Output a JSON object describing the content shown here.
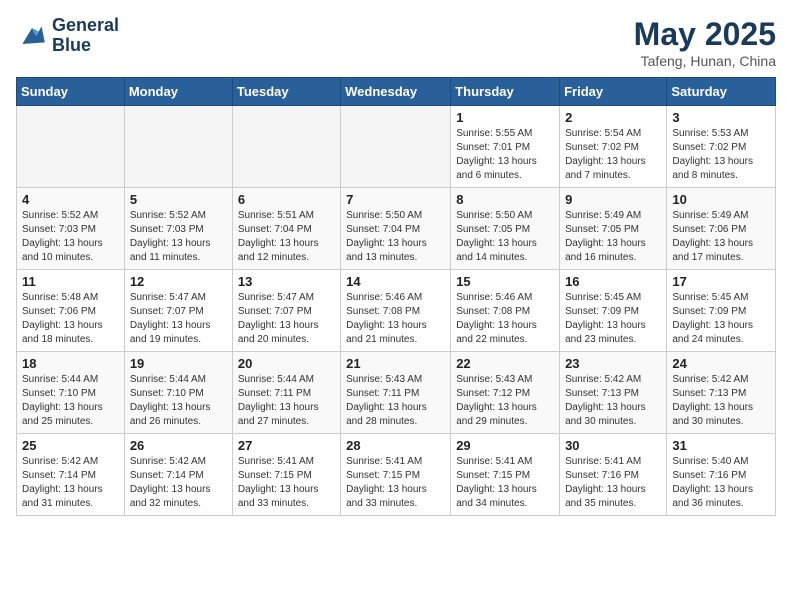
{
  "header": {
    "logo_line1": "General",
    "logo_line2": "Blue",
    "month_year": "May 2025",
    "location": "Tafeng, Hunan, China"
  },
  "days_of_week": [
    "Sunday",
    "Monday",
    "Tuesday",
    "Wednesday",
    "Thursday",
    "Friday",
    "Saturday"
  ],
  "weeks": [
    [
      {
        "day": "",
        "info": "",
        "empty": true
      },
      {
        "day": "",
        "info": "",
        "empty": true
      },
      {
        "day": "",
        "info": "",
        "empty": true
      },
      {
        "day": "",
        "info": "",
        "empty": true
      },
      {
        "day": "1",
        "info": "Sunrise: 5:55 AM\nSunset: 7:01 PM\nDaylight: 13 hours\nand 6 minutes."
      },
      {
        "day": "2",
        "info": "Sunrise: 5:54 AM\nSunset: 7:02 PM\nDaylight: 13 hours\nand 7 minutes."
      },
      {
        "day": "3",
        "info": "Sunrise: 5:53 AM\nSunset: 7:02 PM\nDaylight: 13 hours\nand 8 minutes."
      }
    ],
    [
      {
        "day": "4",
        "info": "Sunrise: 5:52 AM\nSunset: 7:03 PM\nDaylight: 13 hours\nand 10 minutes."
      },
      {
        "day": "5",
        "info": "Sunrise: 5:52 AM\nSunset: 7:03 PM\nDaylight: 13 hours\nand 11 minutes."
      },
      {
        "day": "6",
        "info": "Sunrise: 5:51 AM\nSunset: 7:04 PM\nDaylight: 13 hours\nand 12 minutes."
      },
      {
        "day": "7",
        "info": "Sunrise: 5:50 AM\nSunset: 7:04 PM\nDaylight: 13 hours\nand 13 minutes."
      },
      {
        "day": "8",
        "info": "Sunrise: 5:50 AM\nSunset: 7:05 PM\nDaylight: 13 hours\nand 14 minutes."
      },
      {
        "day": "9",
        "info": "Sunrise: 5:49 AM\nSunset: 7:05 PM\nDaylight: 13 hours\nand 16 minutes."
      },
      {
        "day": "10",
        "info": "Sunrise: 5:49 AM\nSunset: 7:06 PM\nDaylight: 13 hours\nand 17 minutes."
      }
    ],
    [
      {
        "day": "11",
        "info": "Sunrise: 5:48 AM\nSunset: 7:06 PM\nDaylight: 13 hours\nand 18 minutes."
      },
      {
        "day": "12",
        "info": "Sunrise: 5:47 AM\nSunset: 7:07 PM\nDaylight: 13 hours\nand 19 minutes."
      },
      {
        "day": "13",
        "info": "Sunrise: 5:47 AM\nSunset: 7:07 PM\nDaylight: 13 hours\nand 20 minutes."
      },
      {
        "day": "14",
        "info": "Sunrise: 5:46 AM\nSunset: 7:08 PM\nDaylight: 13 hours\nand 21 minutes."
      },
      {
        "day": "15",
        "info": "Sunrise: 5:46 AM\nSunset: 7:08 PM\nDaylight: 13 hours\nand 22 minutes."
      },
      {
        "day": "16",
        "info": "Sunrise: 5:45 AM\nSunset: 7:09 PM\nDaylight: 13 hours\nand 23 minutes."
      },
      {
        "day": "17",
        "info": "Sunrise: 5:45 AM\nSunset: 7:09 PM\nDaylight: 13 hours\nand 24 minutes."
      }
    ],
    [
      {
        "day": "18",
        "info": "Sunrise: 5:44 AM\nSunset: 7:10 PM\nDaylight: 13 hours\nand 25 minutes."
      },
      {
        "day": "19",
        "info": "Sunrise: 5:44 AM\nSunset: 7:10 PM\nDaylight: 13 hours\nand 26 minutes."
      },
      {
        "day": "20",
        "info": "Sunrise: 5:44 AM\nSunset: 7:11 PM\nDaylight: 13 hours\nand 27 minutes."
      },
      {
        "day": "21",
        "info": "Sunrise: 5:43 AM\nSunset: 7:11 PM\nDaylight: 13 hours\nand 28 minutes."
      },
      {
        "day": "22",
        "info": "Sunrise: 5:43 AM\nSunset: 7:12 PM\nDaylight: 13 hours\nand 29 minutes."
      },
      {
        "day": "23",
        "info": "Sunrise: 5:42 AM\nSunset: 7:13 PM\nDaylight: 13 hours\nand 30 minutes."
      },
      {
        "day": "24",
        "info": "Sunrise: 5:42 AM\nSunset: 7:13 PM\nDaylight: 13 hours\nand 30 minutes."
      }
    ],
    [
      {
        "day": "25",
        "info": "Sunrise: 5:42 AM\nSunset: 7:14 PM\nDaylight: 13 hours\nand 31 minutes."
      },
      {
        "day": "26",
        "info": "Sunrise: 5:42 AM\nSunset: 7:14 PM\nDaylight: 13 hours\nand 32 minutes."
      },
      {
        "day": "27",
        "info": "Sunrise: 5:41 AM\nSunset: 7:15 PM\nDaylight: 13 hours\nand 33 minutes."
      },
      {
        "day": "28",
        "info": "Sunrise: 5:41 AM\nSunset: 7:15 PM\nDaylight: 13 hours\nand 33 minutes."
      },
      {
        "day": "29",
        "info": "Sunrise: 5:41 AM\nSunset: 7:15 PM\nDaylight: 13 hours\nand 34 minutes."
      },
      {
        "day": "30",
        "info": "Sunrise: 5:41 AM\nSunset: 7:16 PM\nDaylight: 13 hours\nand 35 minutes."
      },
      {
        "day": "31",
        "info": "Sunrise: 5:40 AM\nSunset: 7:16 PM\nDaylight: 13 hours\nand 36 minutes."
      }
    ]
  ]
}
